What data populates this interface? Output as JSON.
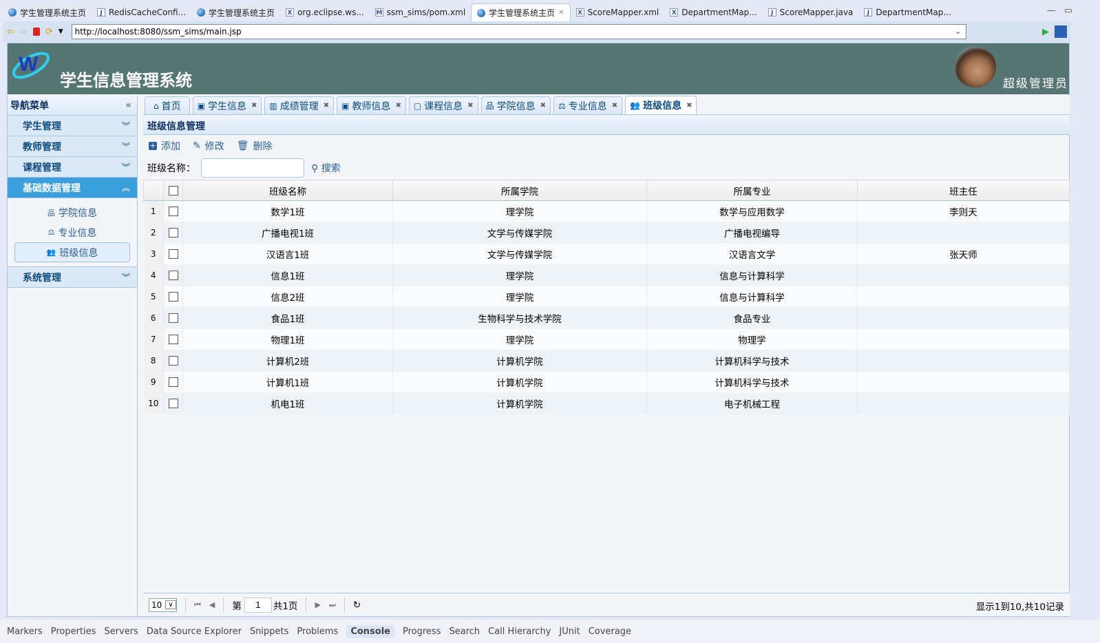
{
  "editor_tabs": [
    {
      "label": "学生管理系统主页",
      "icon": "globe-icon"
    },
    {
      "label": "RedisCacheConfi...",
      "icon": "java-file-icon"
    },
    {
      "label": "学生管理系统主页",
      "icon": "globe-icon"
    },
    {
      "label": "org.eclipse.ws...",
      "icon": "xml-file-icon"
    },
    {
      "label": "ssm_sims/pom.xml",
      "icon": "maven-file-icon"
    },
    {
      "label": "学生管理系统主页",
      "icon": "globe-icon",
      "active": true
    },
    {
      "label": "ScoreMapper.xml",
      "icon": "xml-file-icon"
    },
    {
      "label": "DepartmentMap...",
      "icon": "xml-file-icon"
    },
    {
      "label": "ScoreMapper.java",
      "icon": "java-file-icon"
    },
    {
      "label": "DepartmentMap...",
      "icon": "java-file-icon"
    }
  ],
  "browser": {
    "url": "http://localhost:8080/ssm_sims/main.jsp"
  },
  "header": {
    "title": "学生信息管理系统",
    "role": "超级管理员"
  },
  "sidebar": {
    "title": "导航菜单",
    "sections": [
      {
        "label": "学生管理"
      },
      {
        "label": "教师管理"
      },
      {
        "label": "课程管理"
      },
      {
        "label": "基础数据管理",
        "items": [
          {
            "label": "学院信息"
          },
          {
            "label": "专业信息"
          },
          {
            "label": "班级信息"
          }
        ]
      },
      {
        "label": "系统管理"
      }
    ]
  },
  "tabs": [
    {
      "label": "首页"
    },
    {
      "label": "学生信息"
    },
    {
      "label": "成绩管理"
    },
    {
      "label": "教师信息"
    },
    {
      "label": "课程信息"
    },
    {
      "label": "学院信息"
    },
    {
      "label": "专业信息"
    },
    {
      "label": "班级信息"
    }
  ],
  "panel": {
    "title": "班级信息管理",
    "add": "添加",
    "edit": "修改",
    "delete": "删除",
    "search_label": "班级名称：",
    "search_value": "",
    "search_button": "搜索"
  },
  "table": {
    "columns": [
      "班级名称",
      "所属学院",
      "所属专业",
      "班主任"
    ],
    "rows": [
      [
        "数学1班",
        "理学院",
        "数学与应用数学",
        "李则天"
      ],
      [
        "广播电视1班",
        "文学与传媒学院",
        "广播电视编导",
        ""
      ],
      [
        "汉语言1班",
        "文学与传媒学院",
        "汉语言文学",
        "张天师"
      ],
      [
        "信息1班",
        "理学院",
        "信息与计算科学",
        ""
      ],
      [
        "信息2班",
        "理学院",
        "信息与计算科学",
        ""
      ],
      [
        "食品1班",
        "生物科学与技术学院",
        "食品专业",
        ""
      ],
      [
        "物理1班",
        "理学院",
        "物理学",
        ""
      ],
      [
        "计算机2班",
        "计算机学院",
        "计算机科学与技术",
        ""
      ],
      [
        "计算机1班",
        "计算机学院",
        "计算机科学与技术",
        ""
      ],
      [
        "机电1班",
        "计算机学院",
        "电子机械工程",
        ""
      ]
    ]
  },
  "pager": {
    "page_size": "10",
    "page_prefix": "第",
    "page": "1",
    "page_total": "共1页",
    "info": "显示1到10,共10记录"
  },
  "bottom_views": [
    "Markers",
    "Properties",
    "Servers",
    "Data Source Explorer",
    "Snippets",
    "Problems",
    "Console",
    "Progress",
    "Search",
    "Call Hierarchy",
    "JUnit",
    "Coverage"
  ]
}
